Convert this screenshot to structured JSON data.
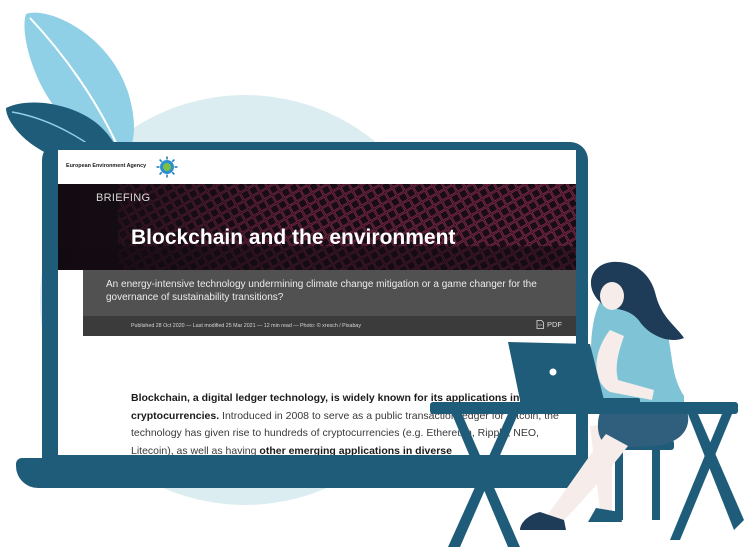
{
  "site": {
    "logo_text": "European Environment Agency"
  },
  "article": {
    "category": "BRIEFING",
    "title": "Blockchain and the environment",
    "summary": "An energy-intensive technology undermining climate change mitigation or a game changer for the governance of sustainability transitions?",
    "meta": "Published 28 Oct 2020  — Last modified 25 Mar 2021  — 12 min read  — Photo: © xresch / Pixabay",
    "pdf_label": "PDF",
    "body": {
      "lead_bold": "Blockchain, a digital ledger technology, is widely known for its applications in cryptocurrencies.",
      "text_1": " Introduced in 2008 to serve as a public transaction ledger for Bitcoin, the technology has given rise to hundreds of cryptocurrencies (e.g. Ethereum, Ripple, NEO, Litecoin), as well as having ",
      "bold_2": "other emerging applications in diverse"
    }
  },
  "colors": {
    "laptop": "#1e5c79",
    "background_circle": "#dcedf2",
    "leaf_light": "#8fd0e6",
    "leaf_dark": "#1e5c79",
    "woman_top": "#7fc3d6",
    "woman_pants": "#2f5f7d",
    "desk": "#1e5c79"
  }
}
